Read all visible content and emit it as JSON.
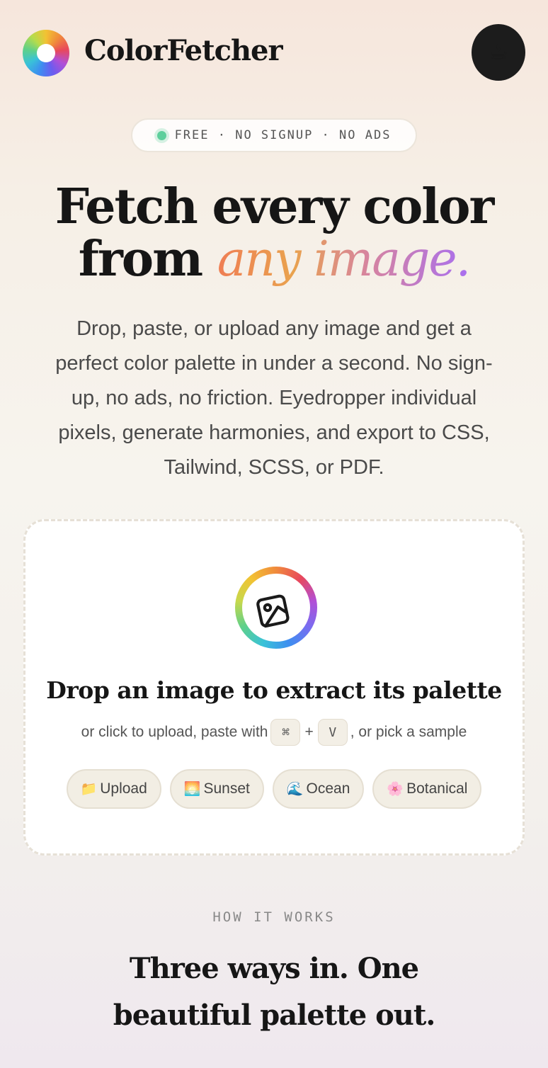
{
  "app": {
    "brand": "ColorFetcher",
    "coffee_icon": "☕"
  },
  "badge": {
    "text": "FREE · NO SIGNUP · NO ADS"
  },
  "hero": {
    "line1": "Fetch every color",
    "line2_prefix": "from ",
    "line2_accent": "any image.",
    "description": "Drop, paste, or upload any image and get a perfect color palette in under a second. No sign-up, no ads, no friction. Eyedropper individual pixels, generate harmonies, and export to CSS, Tailwind, SCSS, or PDF."
  },
  "dropzone": {
    "title": "Drop an image to extract its palette",
    "sub_prefix": "or click to upload, paste with",
    "key_cmd": "⌘",
    "plus": "+",
    "key_v": "V",
    "sub_suffix": ", or pick a sample",
    "chips": [
      {
        "icon": "📁",
        "label": "Upload"
      },
      {
        "icon": "🌅",
        "label": "Sunset"
      },
      {
        "icon": "🌊",
        "label": "Ocean"
      },
      {
        "icon": "🌸",
        "label": "Botanical"
      }
    ]
  },
  "how": {
    "eyebrow": "HOW IT WORKS",
    "title": "Three ways in. One beautiful palette out."
  },
  "colors": {
    "status_dot": "#5ecf9c",
    "coffee_button_bg": "#1c1c1c",
    "accent_start": "#ef7e54",
    "accent_end": "#a86ff0"
  }
}
